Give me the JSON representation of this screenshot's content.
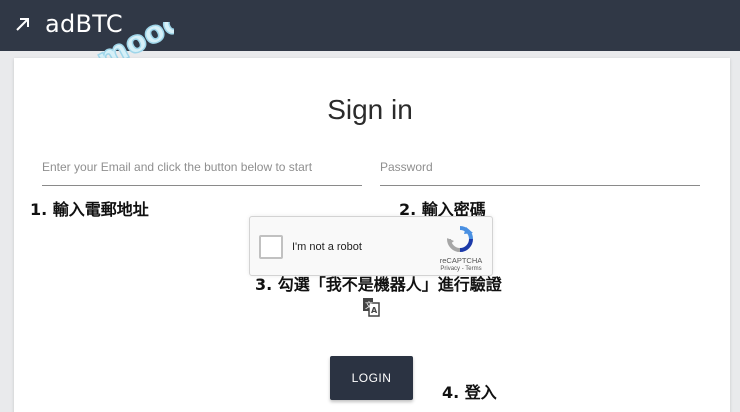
{
  "header": {
    "brand": "adBTC",
    "icon": "arrow-up-right-icon",
    "background": "#303846"
  },
  "watermark": {
    "text": "Moonmood",
    "color": "#9fd6ea"
  },
  "form": {
    "title": "Sign in",
    "email_placeholder": "Enter your Email and click the button below to start",
    "password_placeholder": "Password",
    "login_label": "LOGIN"
  },
  "captcha": {
    "label": "I'm not a robot",
    "brand": "reCAPTCHA",
    "links": "Privacy - Terms"
  },
  "annotations": {
    "step1": "1. 輸入電郵地址",
    "step2": "2. 輸入密碼",
    "step3": "3. 勾選「我不是機器人」進行驗證",
    "step4": "4. 登入"
  },
  "translate_icon": "translate-icon",
  "colors": {
    "button": "#2b3342",
    "text": "#2b2b2b"
  }
}
